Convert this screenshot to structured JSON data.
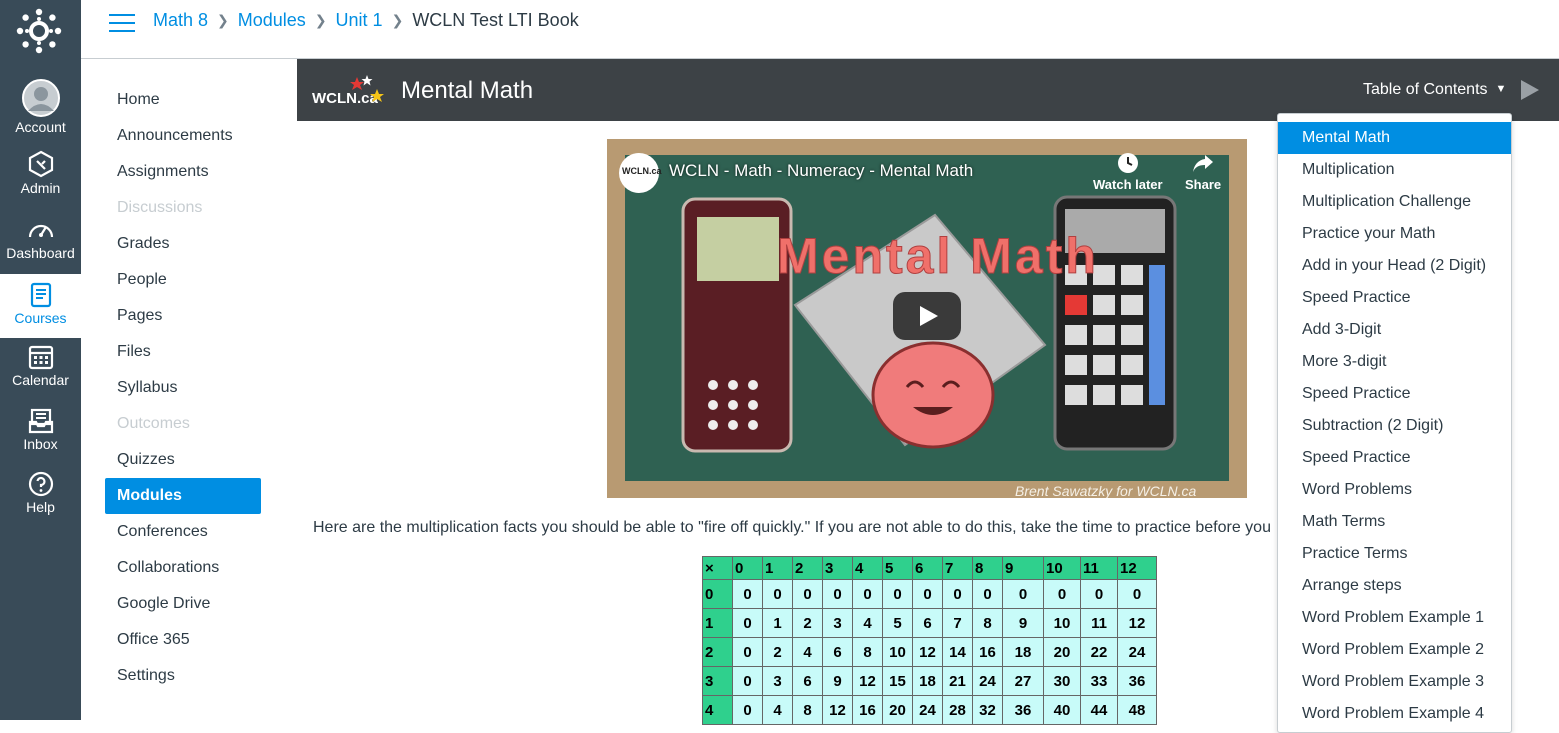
{
  "global_nav": {
    "items": [
      {
        "label": "Account",
        "icon": "account-icon"
      },
      {
        "label": "Admin",
        "icon": "admin-icon"
      },
      {
        "label": "Dashboard",
        "icon": "dashboard-icon"
      },
      {
        "label": "Courses",
        "icon": "courses-icon",
        "active": true
      },
      {
        "label": "Calendar",
        "icon": "calendar-icon"
      },
      {
        "label": "Inbox",
        "icon": "inbox-icon"
      },
      {
        "label": "Help",
        "icon": "help-icon"
      }
    ]
  },
  "breadcrumb": {
    "items": [
      "Math 8",
      "Modules",
      "Unit 1",
      "WCLN Test LTI Book"
    ]
  },
  "course_nav": {
    "items": [
      "Home",
      "Announcements",
      "Assignments",
      "Discussions",
      "Grades",
      "People",
      "Pages",
      "Files",
      "Syllabus",
      "Outcomes",
      "Quizzes",
      "Modules",
      "Conferences",
      "Collaborations",
      "Google Drive",
      "Office 365",
      "Settings"
    ],
    "disabled": [
      "Discussions",
      "Outcomes"
    ],
    "active": "Modules"
  },
  "book": {
    "logo_text": "WCLN.ca",
    "title": "Mental Math",
    "toc_label": "Table of Contents"
  },
  "toc": {
    "items": [
      "Mental Math",
      "Multiplication",
      "Multiplication Challenge",
      "Practice your Math",
      "Add in your Head (2 Digit)",
      "Speed Practice",
      "Add 3-Digit",
      "More 3-digit",
      "Speed Practice",
      "Subtraction (2 Digit)",
      "Speed Practice",
      "Word Problems",
      "Math Terms",
      "Practice Terms",
      "Arrange steps",
      "Word Problem Example 1",
      "Word Problem Example 2",
      "Word Problem Example 3",
      "Word Problem Example 4"
    ],
    "active_index": 0
  },
  "video": {
    "title": "WCLN - Math - Numeracy - Mental Math",
    "overlay_title": "Mental Math",
    "watch_later": "Watch later",
    "share": "Share",
    "credit": "Brent Sawatzky for WCLN.ca",
    "channel": "WCLN.ca"
  },
  "content": {
    "intro": "Here are the multiplication facts you should be able to \"fire off quickly.\"   If you are not able to do this, take the time to practice before you"
  },
  "mult_table": {
    "corner": "×",
    "header": [
      "0",
      "1",
      "2",
      "3",
      "4",
      "5",
      "6",
      "7",
      "8",
      "9",
      "10",
      "11",
      "12"
    ],
    "rows": [
      {
        "h": "0",
        "cells": [
          "0",
          "0",
          "0",
          "0",
          "0",
          "0",
          "0",
          "0",
          "0",
          "0",
          "0",
          "0",
          "0"
        ]
      },
      {
        "h": "1",
        "cells": [
          "0",
          "1",
          "2",
          "3",
          "4",
          "5",
          "6",
          "7",
          "8",
          "9",
          "10",
          "11",
          "12"
        ]
      },
      {
        "h": "2",
        "cells": [
          "0",
          "2",
          "4",
          "6",
          "8",
          "10",
          "12",
          "14",
          "16",
          "18",
          "20",
          "22",
          "24"
        ]
      },
      {
        "h": "3",
        "cells": [
          "0",
          "3",
          "6",
          "9",
          "12",
          "15",
          "18",
          "21",
          "24",
          "27",
          "30",
          "33",
          "36"
        ]
      },
      {
        "h": "4",
        "cells": [
          "0",
          "4",
          "8",
          "12",
          "16",
          "20",
          "24",
          "28",
          "32",
          "36",
          "40",
          "44",
          "48"
        ]
      }
    ]
  },
  "colors": {
    "nav_bg": "#394b58",
    "accent": "#008ee2",
    "book_header": "#3d4246",
    "table_header": "#2fd08d",
    "table_cell": "#c8fbf9"
  }
}
